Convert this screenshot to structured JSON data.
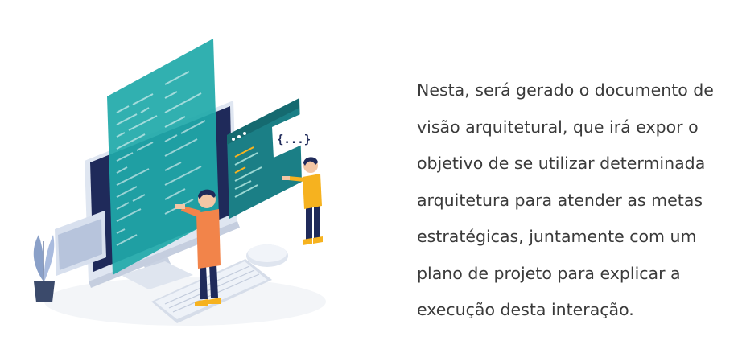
{
  "description_lines": [
    "Nesta, será gerado o documento de",
    "visão arquitetural, que irá expor o",
    "objetivo de se utilizar determinada",
    "arquitetura para atender as metas",
    "estratégicas, juntamente com um",
    "plano de projeto para explicar a",
    "execução desta interação."
  ],
  "illustration": {
    "code_badge": "{...}",
    "accent_colors": {
      "teal": "#1fa9a9",
      "dark_teal": "#1b7f86",
      "orange": "#f2844a",
      "yellow": "#f6b21f",
      "navy": "#1f2a5a"
    }
  }
}
